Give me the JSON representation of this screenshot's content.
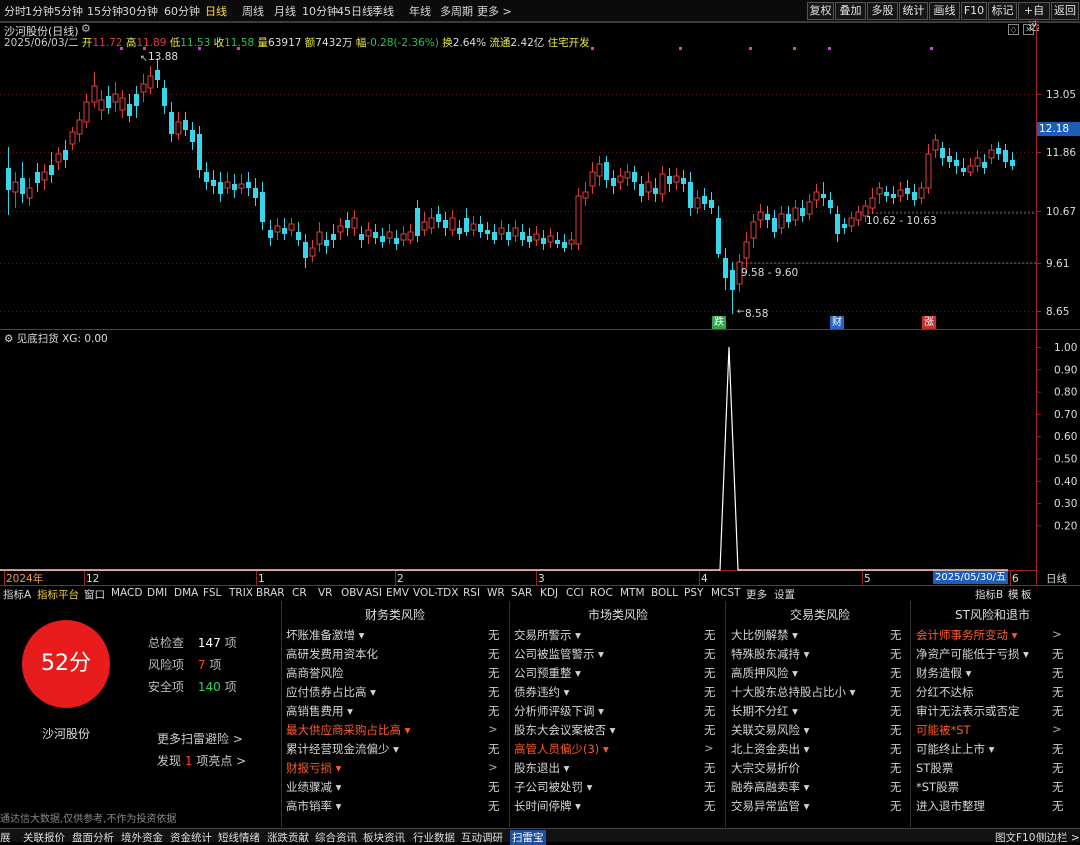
{
  "topbar": {
    "periods": [
      "分时",
      "1分钟",
      "5分钟",
      "15分钟",
      "30分钟",
      "60分钟",
      "日线",
      "周线",
      "月线",
      "10分钟",
      "45日线",
      "季线",
      "年线",
      "多周期",
      "更多 >"
    ],
    "active_period": "日线",
    "tools": [
      "复权",
      "叠加",
      "多股",
      "统计",
      "画线",
      "F10",
      "标记",
      "+自选",
      "返回"
    ]
  },
  "stock": {
    "name": "沙河股份(日线)",
    "date": "2025/06/03/二",
    "open_label": "开",
    "open": "11.72",
    "high_label": "高",
    "high": "11.89",
    "low_label": "低",
    "low": "11.53",
    "close_label": "收",
    "close": "11.58",
    "vol_label": "量",
    "vol": "63917",
    "amt_label": "额",
    "amt": "7432万",
    "chg_label": "幅",
    "chg": "-0.28(-2.36%)",
    "turn_label": "换",
    "turn": "2.64%",
    "float_label": "流通",
    "float": "2.42亿",
    "sector": "住宅开发"
  },
  "price_axis": {
    "ticks": [
      "13.05",
      "11.86",
      "10.67",
      "9.61",
      "8.65"
    ],
    "current": "12.18"
  },
  "annotations": {
    "high": "13.88",
    "low": "8.58",
    "range1": "9.58 - 9.60",
    "range2": "10.62 - 10.63",
    "events": [
      {
        "label": "跌",
        "color": "#2ea84a"
      },
      {
        "label": "财",
        "color": "#2a64c8"
      },
      {
        "label": "涨",
        "color": "#c43030"
      }
    ]
  },
  "indicator": {
    "name": "见底扫货",
    "value": "XG: 0.00",
    "ticks": [
      "1.00",
      "0.90",
      "0.80",
      "0.70",
      "0.60",
      "0.50",
      "0.40",
      "0.30",
      "0.20"
    ],
    "peak": 1.0
  },
  "time_axis": {
    "labels": [
      "2024年",
      "12",
      "1",
      "2",
      "3",
      "4",
      "5",
      "6"
    ],
    "current_date": "2025/05/30/五",
    "period": "日线"
  },
  "indicator_tabs": [
    "指标A",
    "指标平台",
    "窗口",
    "MACD",
    "DMI",
    "DMA",
    "FSL",
    "TRIX",
    "BRAR",
    "CR",
    "VR",
    "OBV",
    "ASI",
    "EMV",
    "VOL-TDX",
    "RSI",
    "WR",
    "SAR",
    "KDJ",
    "CCI",
    "ROC",
    "MTM",
    "BOLL",
    "PSY",
    "MCST",
    "更多",
    "设置"
  ],
  "indicator_tabs_right": [
    "指标B",
    "模",
    "板"
  ],
  "score": {
    "value": "52分",
    "stock_name": "沙河股份",
    "total_label": "总检查",
    "total": "147",
    "total_unit": "项",
    "risk_label": "风险项",
    "risk": "7",
    "risk_unit": "项",
    "safe_label": "安全项",
    "safe": "140",
    "safe_unit": "项",
    "more": "更多扫雷避险 >",
    "found_pre": "发现",
    "found": "1",
    "found_post": "项亮点 >",
    "disclaimer": "通达信大数据,仅供参考,不作为投资依据"
  },
  "columns": [
    {
      "title": "财务类风险",
      "items": [
        {
          "label": "坏账准备激增 ▾",
          "val": "无",
          "warn": false
        },
        {
          "label": "高研发费用资本化",
          "val": "无",
          "warn": false
        },
        {
          "label": "高商誉风险",
          "val": "无",
          "warn": false
        },
        {
          "label": "应付债券占比高 ▾",
          "val": "无",
          "warn": false
        },
        {
          "label": "高销售费用 ▾",
          "val": "无",
          "warn": false
        },
        {
          "label": "最大供应商采购占比高 ▾",
          "val": ">",
          "warn": true
        },
        {
          "label": "累计经营现金流偏少 ▾",
          "val": "无",
          "warn": false
        },
        {
          "label": "财报亏损 ▾",
          "val": ">",
          "warn": true
        },
        {
          "label": "业绩骤减 ▾",
          "val": "无",
          "warn": false
        },
        {
          "label": "高市销率 ▾",
          "val": "无",
          "warn": false
        }
      ]
    },
    {
      "title": "市场类风险",
      "items": [
        {
          "label": "交易所警示 ▾",
          "val": "无",
          "warn": false
        },
        {
          "label": "公司被监管警示 ▾",
          "val": "无",
          "warn": false
        },
        {
          "label": "公司预重整 ▾",
          "val": "无",
          "warn": false
        },
        {
          "label": "债券违约 ▾",
          "val": "无",
          "warn": false
        },
        {
          "label": "分析师评级下调 ▾",
          "val": "无",
          "warn": false
        },
        {
          "label": "股东大会议案被否 ▾",
          "val": "无",
          "warn": false
        },
        {
          "label": "高管人员偏少(3) ▾",
          "val": ">",
          "warn": true
        },
        {
          "label": "股东退出 ▾",
          "val": "无",
          "warn": false
        },
        {
          "label": "子公司被处罚 ▾",
          "val": "无",
          "warn": false
        },
        {
          "label": "长时间停牌 ▾",
          "val": "无",
          "warn": false
        }
      ]
    },
    {
      "title": "交易类风险",
      "items": [
        {
          "label": "大比例解禁 ▾",
          "val": "无",
          "warn": false
        },
        {
          "label": "特殊股东减持 ▾",
          "val": "无",
          "warn": false
        },
        {
          "label": "高质押风险 ▾",
          "val": "无",
          "warn": false
        },
        {
          "label": "十大股东总持股占比小 ▾",
          "val": "无",
          "warn": false
        },
        {
          "label": "长期不分红 ▾",
          "val": "无",
          "warn": false
        },
        {
          "label": "关联交易风险 ▾",
          "val": "无",
          "warn": false
        },
        {
          "label": "北上资金卖出 ▾",
          "val": "无",
          "warn": false
        },
        {
          "label": "大宗交易折价",
          "val": "无",
          "warn": false
        },
        {
          "label": "融券高融卖率 ▾",
          "val": "无",
          "warn": false
        },
        {
          "label": "交易异常监管 ▾",
          "val": "无",
          "warn": false
        }
      ]
    },
    {
      "title": "ST风险和退市",
      "items": [
        {
          "label": "会计师事务所变动 ▾",
          "val": ">",
          "warn": true
        },
        {
          "label": "净资产可能低于亏损 ▾",
          "val": "无",
          "warn": false
        },
        {
          "label": "财务造假 ▾",
          "val": "无",
          "warn": false
        },
        {
          "label": "分红不达标",
          "val": "无",
          "warn": false
        },
        {
          "label": "审计无法表示或否定",
          "val": "无",
          "warn": false
        },
        {
          "label": "可能被*ST",
          "val": ">",
          "warn": true
        },
        {
          "label": "可能终止上市 ▾",
          "val": "无",
          "warn": false
        },
        {
          "label": "ST股票",
          "val": "无",
          "warn": false
        },
        {
          "label": "*ST股票",
          "val": "无",
          "warn": false
        },
        {
          "label": "进入退市整理",
          "val": "无",
          "warn": false
        }
      ]
    }
  ],
  "bottom_tabs": [
    "展",
    "关联报价",
    "盘面分析",
    "境外资金",
    "资金统计",
    "短线情绪",
    "涨跌贡献",
    "综合资讯",
    "板块资讯",
    "行业数据",
    "互动调研",
    "扫雷宝"
  ],
  "bottom_right": [
    "图文F10",
    "侧边栏 >"
  ],
  "colors": {
    "up": "#e23c3c",
    "down": "#38d6ea",
    "warn": "#ff5a28",
    "score_bg": "#e81c1c"
  }
}
